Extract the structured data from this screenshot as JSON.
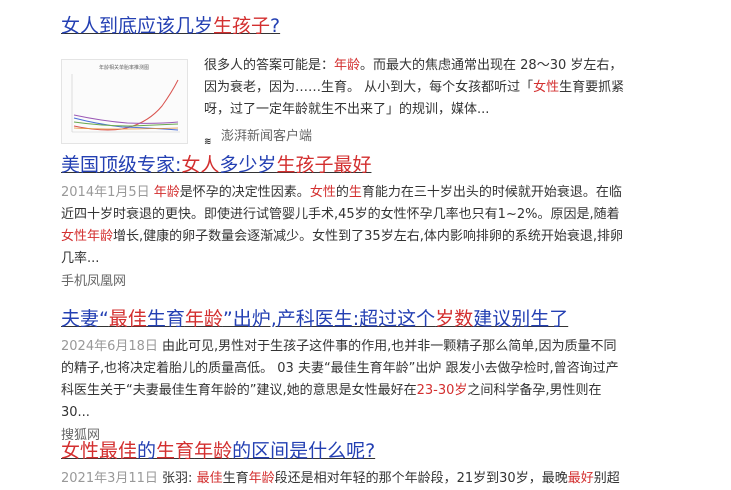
{
  "results": [
    {
      "title_parts": [
        {
          "text": "女人到底应该几岁",
          "hl": false
        },
        {
          "text": "生孩子",
          "hl": true
        },
        {
          "text": "?",
          "hl": false
        }
      ],
      "snippet_parts": [
        {
          "text": "很多人的答案可能是：",
          "hl": false
        },
        {
          "text": "年龄",
          "hl": true
        },
        {
          "text": "。而最大的焦虑通常出现在 28～30 岁左右，因为衰老，因为……生育。 从小到大，每个女孩都听过「",
          "hl": false
        },
        {
          "text": "女性",
          "hl": true
        },
        {
          "text": "生育要抓紧呀，过了一定年龄就生不出来了」的规训，媒体...",
          "hl": false
        }
      ],
      "source": "澎湃新闻客户端",
      "thumbnail_title": "年龄相关单胎率推测图"
    },
    {
      "title_parts": [
        {
          "text": "美国顶级专家:",
          "hl": false
        },
        {
          "text": "女人",
          "hl": true
        },
        {
          "text": "多少岁",
          "hl": false
        },
        {
          "text": "生孩子最好",
          "hl": true
        }
      ],
      "date": "2014年1月5日",
      "snippet_parts": [
        {
          "text": "年龄",
          "hl": true
        },
        {
          "text": "是怀孕的决定性因素。",
          "hl": false
        },
        {
          "text": "女性",
          "hl": true
        },
        {
          "text": "的",
          "hl": false
        },
        {
          "text": "生",
          "hl": true
        },
        {
          "text": "育能力在三十岁出头的时候就开始衰退。在临近四十岁时衰退的更快。即使进行试管婴儿手术,45岁的女性怀孕几率也只有1~2%。原因是,随着",
          "hl": false
        },
        {
          "text": "女性年龄",
          "hl": true
        },
        {
          "text": "增长,健康的卵子数量会逐渐减少。女性到了35岁左右,体内影响排卵的系统开始衰退,排卵几率...",
          "hl": false
        }
      ],
      "source": "手机凤凰网"
    },
    {
      "title_parts": [
        {
          "text": "夫妻“",
          "hl": false
        },
        {
          "text": "最佳",
          "hl": true
        },
        {
          "text": "生育",
          "hl": false
        },
        {
          "text": "年龄",
          "hl": true
        },
        {
          "text": "”出炉,产科医生:超过这个",
          "hl": false
        },
        {
          "text": "岁数",
          "hl": true
        },
        {
          "text": "建议别生了",
          "hl": false
        }
      ],
      "date": "2024年6月18日",
      "snippet_parts": [
        {
          "text": "由此可见,男性对于生孩子这件事的作用,也并非一颗精子那么简单,因为质量不同的精子,也将决定着胎儿的质量高低。 03 夫妻“最佳生育年龄”出炉 跟发小去做孕检时,曾咨询过产科医生关于“夫妻最佳生育年龄的”建议,她的意思是女性最好在",
          "hl": false
        },
        {
          "text": "23-30岁",
          "hl": true
        },
        {
          "text": "之间科学备孕,男性则在30...",
          "hl": false
        }
      ],
      "source": "搜狐网"
    },
    {
      "title_parts": [
        {
          "text": "女性",
          "hl": true
        },
        {
          "text": "最佳",
          "hl": true
        },
        {
          "text": "的",
          "hl": false
        },
        {
          "text": "生育",
          "hl": true
        },
        {
          "text": "年龄",
          "hl": true
        },
        {
          "text": "的区间是什么呢?",
          "hl": false
        }
      ],
      "date": "2021年3月11日",
      "snippet_parts": [
        {
          "text": "张羽: ",
          "hl": false
        },
        {
          "text": "最佳",
          "hl": true
        },
        {
          "text": "生育",
          "hl": false
        },
        {
          "text": "年龄",
          "hl": true
        },
        {
          "text": "段还是相对年轻的那个年龄段，21岁到30岁，最晚",
          "hl": false
        },
        {
          "text": "最好",
          "hl": true
        },
        {
          "text": "别超",
          "hl": false
        }
      ]
    }
  ],
  "colors": {
    "link": "#2440b3",
    "highlight": "#d32f2f",
    "meta": "#999999",
    "source": "#666666"
  }
}
